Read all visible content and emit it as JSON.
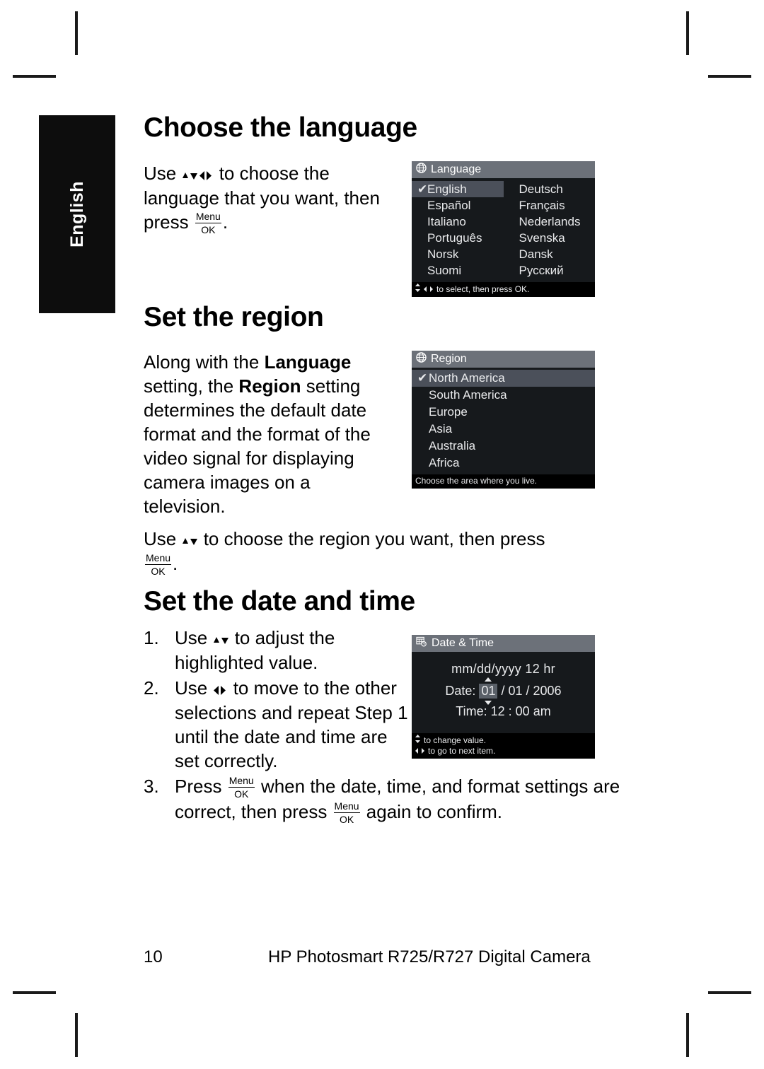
{
  "side_tab": {
    "label": "English"
  },
  "sections": {
    "language": {
      "heading": "Choose the language",
      "body_pre": "Use ",
      "body_mid": " to choose the language that you want, then press ",
      "body_post": ".",
      "menu_ok": {
        "top": "Menu",
        "bottom": "OK"
      }
    },
    "region": {
      "heading": "Set the region",
      "para1_a": "Along with the ",
      "para1_b": "Language",
      "para1_c": " setting, the ",
      "para1_d": "Region",
      "para1_e": " setting determines the default date format and the format of the video signal for displaying camera images on a television.",
      "para2_pre": "Use ",
      "para2_mid": " to choose the region you want, then press ",
      "para2_post": "."
    },
    "date_time": {
      "heading": "Set the date and time",
      "steps": [
        {
          "num": "1.",
          "pre": "Use ",
          "arrows": "up-down",
          "post": " to adjust the highlighted value."
        },
        {
          "num": "2.",
          "pre": "Use ",
          "arrows": "left-right",
          "post": " to move to the other selections and repeat Step 1 until the date and time are set correctly."
        }
      ],
      "step3": {
        "num": "3.",
        "a": "Press ",
        "b": " when the date, time, and format settings are correct, then press ",
        "c": " again to confirm."
      }
    }
  },
  "screens": {
    "language": {
      "icon": "globe-icon",
      "title": "Language",
      "selected": "English",
      "items_left": [
        "English",
        "Español",
        "Italiano",
        "Português",
        "Norsk",
        "Suomi"
      ],
      "items_right": [
        "Deutsch",
        "Français",
        "Nederlands",
        "Svenska",
        "Dansk",
        "Русский"
      ],
      "footer_hint": "to select, then press OK.",
      "check_glyph": "✔"
    },
    "region": {
      "icon": "globe-icon",
      "title": "Region",
      "selected": "North America",
      "items": [
        "North America",
        "South America",
        "Europe",
        "Asia",
        "Australia",
        "Africa"
      ],
      "footer_hint": "Choose the area where you live.",
      "check_glyph": "✔"
    },
    "date_time": {
      "icon": "calendar-clock-icon",
      "title": "Date & Time",
      "format_line": "mm/dd/yyyy  12 hr",
      "date_label": "Date:",
      "date_highlighted": "01",
      "date_rest": "/ 01 / 2006",
      "time_label": "Time:",
      "time_value": "12 : 00  am",
      "footer_hint_1": "to change value.",
      "footer_hint_2": "to go to next item."
    }
  },
  "footer": {
    "page_number": "10",
    "title": "HP Photosmart R725/R727 Digital Camera"
  },
  "colors": {
    "title_bar": "#6c7179",
    "screen_bg": "#16191c",
    "highlight": "#4b505a",
    "screen_text": "#e9eaec",
    "footer_bar": "#000000",
    "side_tab": "#0d0d0d"
  }
}
